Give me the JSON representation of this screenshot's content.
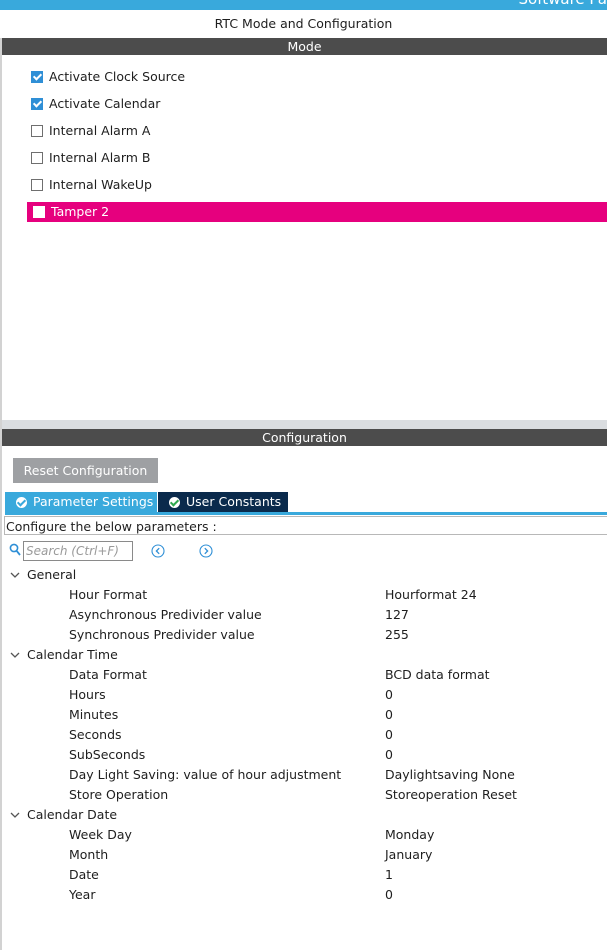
{
  "app": {
    "header_partial": "Software Pa"
  },
  "panel": {
    "title": "RTC Mode and Configuration"
  },
  "mode": {
    "header": "Mode",
    "items": [
      {
        "label": "Activate Clock Source",
        "checked": true
      },
      {
        "label": "Activate Calendar",
        "checked": true
      },
      {
        "label": "Internal Alarm A",
        "checked": false
      },
      {
        "label": "Internal Alarm B",
        "checked": false
      },
      {
        "label": "Internal WakeUp",
        "checked": false
      },
      {
        "label": "Tamper 2",
        "checked": false,
        "highlight_color": "#e6007e"
      }
    ]
  },
  "configuration": {
    "header": "Configuration",
    "reset_button": "Reset Configuration",
    "tabs": [
      {
        "label": "Parameter Settings",
        "active": true
      },
      {
        "label": "User Constants",
        "active": false
      }
    ],
    "instruction": "Configure the below parameters :",
    "search": {
      "placeholder": "Search (Ctrl+F)"
    },
    "groups": [
      {
        "name": "General",
        "params": [
          {
            "name": "Hour Format",
            "value": "Hourformat 24"
          },
          {
            "name": "Asynchronous Predivider value",
            "value": "127"
          },
          {
            "name": "Synchronous Predivider value",
            "value": "255"
          }
        ]
      },
      {
        "name": "Calendar Time",
        "params": [
          {
            "name": "Data Format",
            "value": "BCD data format"
          },
          {
            "name": "Hours",
            "value": "0"
          },
          {
            "name": "Minutes",
            "value": "0"
          },
          {
            "name": "Seconds",
            "value": "0"
          },
          {
            "name": "SubSeconds",
            "value": "0"
          },
          {
            "name": "Day Light Saving: value of hour adjustment",
            "value": "Daylightsaving None"
          },
          {
            "name": "Store Operation",
            "value": "Storeoperation Reset"
          }
        ]
      },
      {
        "name": "Calendar Date",
        "params": [
          {
            "name": "Week Day",
            "value": "Monday"
          },
          {
            "name": "Month",
            "value": "January"
          },
          {
            "name": "Date",
            "value": "1"
          },
          {
            "name": "Year",
            "value": "0"
          }
        ]
      }
    ]
  },
  "colors": {
    "accent": "#39a9dc",
    "dark_tab": "#0a2a4c",
    "highlight": "#e6007e",
    "header_bar": "#4c4c4c"
  }
}
